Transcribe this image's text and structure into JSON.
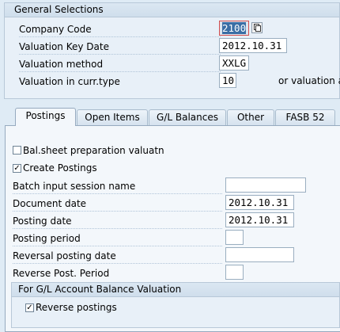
{
  "general": {
    "title": "General Selections",
    "company_code_label": "Company Code",
    "company_code_value": "2100",
    "valuation_key_date_label": "Valuation Key Date",
    "valuation_key_date_value": "2012.10.31",
    "valuation_method_label": "Valuation method",
    "valuation_method_value": "XXLG",
    "valuation_curr_label": "Valuation in curr.type",
    "valuation_curr_value": "10",
    "valuation_area_text": "or valuation ar"
  },
  "tabs": [
    "Postings",
    "Open Items",
    "G/L Balances",
    "Other",
    "FASB 52"
  ],
  "postings": {
    "bal_sheet_label": "Bal.sheet preparation valuatn",
    "bal_sheet_checked": false,
    "create_postings_label": "Create Postings",
    "create_postings_checked": true,
    "batch_session_label": "Batch input session name",
    "batch_session_value": "",
    "document_date_label": "Document date",
    "document_date_value": "2012.10.31",
    "posting_date_label": "Posting date",
    "posting_date_value": "2012.10.31",
    "posting_period_label": "Posting period",
    "posting_period_value": "",
    "reversal_date_label": "Reversal posting date",
    "reversal_date_value": "",
    "reverse_period_label": "Reverse Post. Period",
    "reverse_period_value": ""
  },
  "gl_balance": {
    "title": "For G/L Account Balance Valuation",
    "reverse_postings_label": "Reverse postings",
    "reverse_postings_checked": true
  }
}
